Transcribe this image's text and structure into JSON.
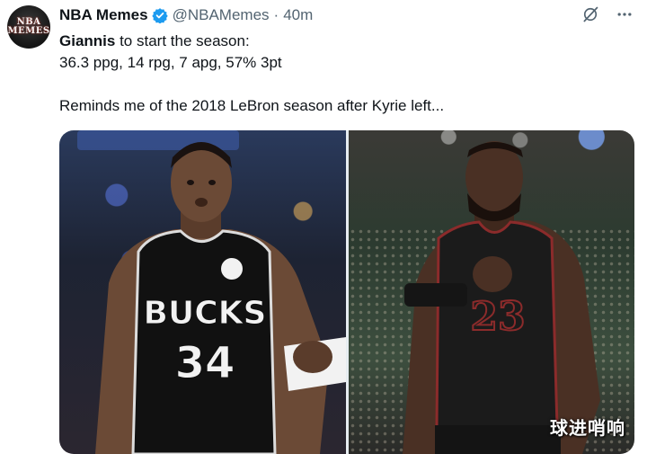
{
  "account": {
    "avatar_text": "NBA\nMEMES",
    "display_name": "NBA Memes",
    "handle": "@NBAMemes",
    "separator": "·",
    "time": "40m",
    "verified_color": "#1d9bf0"
  },
  "tweet": {
    "line1_bold": "Giannis",
    "line1_rest": " to start the season:",
    "line2": "36.3 ppg, 14 rpg, 7 apg, 57% 3pt",
    "line3": "Reminds me of the 2018 LeBron season after Kyrie left..."
  },
  "media": {
    "left": {
      "jersey_text": "BUCKS",
      "jersey_number": "34",
      "jersey_color": "#111111"
    },
    "right": {
      "jersey_number": "23",
      "jersey_color": "#1b1b1b",
      "trim_color": "#8b2b2b"
    },
    "watermark": "球进哨响"
  },
  "icons": {
    "grok": "grok-slash-icon",
    "more": "more-dots-icon"
  }
}
